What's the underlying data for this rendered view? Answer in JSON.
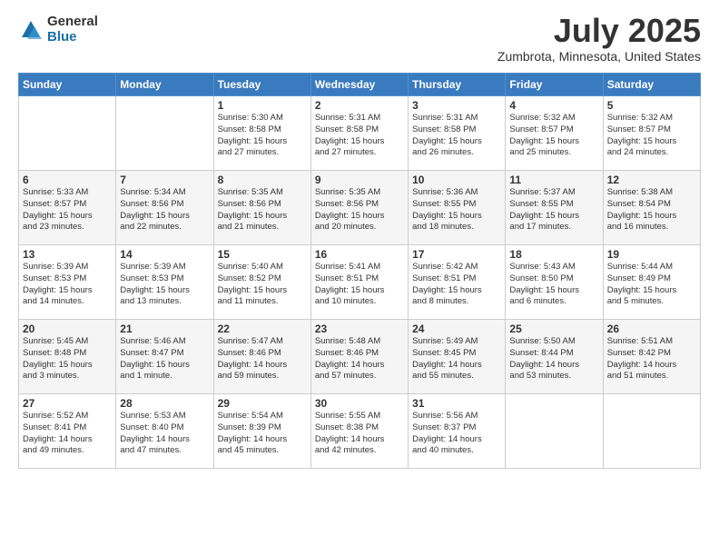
{
  "header": {
    "logo": {
      "general": "General",
      "blue": "Blue"
    },
    "title": "July 2025",
    "location": "Zumbrota, Minnesota, United States"
  },
  "weekdays": [
    "Sunday",
    "Monday",
    "Tuesday",
    "Wednesday",
    "Thursday",
    "Friday",
    "Saturday"
  ],
  "weeks": [
    [
      {
        "day": "",
        "info": ""
      },
      {
        "day": "",
        "info": ""
      },
      {
        "day": "1",
        "info": "Sunrise: 5:30 AM\nSunset: 8:58 PM\nDaylight: 15 hours\nand 27 minutes."
      },
      {
        "day": "2",
        "info": "Sunrise: 5:31 AM\nSunset: 8:58 PM\nDaylight: 15 hours\nand 27 minutes."
      },
      {
        "day": "3",
        "info": "Sunrise: 5:31 AM\nSunset: 8:58 PM\nDaylight: 15 hours\nand 26 minutes."
      },
      {
        "day": "4",
        "info": "Sunrise: 5:32 AM\nSunset: 8:57 PM\nDaylight: 15 hours\nand 25 minutes."
      },
      {
        "day": "5",
        "info": "Sunrise: 5:32 AM\nSunset: 8:57 PM\nDaylight: 15 hours\nand 24 minutes."
      }
    ],
    [
      {
        "day": "6",
        "info": "Sunrise: 5:33 AM\nSunset: 8:57 PM\nDaylight: 15 hours\nand 23 minutes."
      },
      {
        "day": "7",
        "info": "Sunrise: 5:34 AM\nSunset: 8:56 PM\nDaylight: 15 hours\nand 22 minutes."
      },
      {
        "day": "8",
        "info": "Sunrise: 5:35 AM\nSunset: 8:56 PM\nDaylight: 15 hours\nand 21 minutes."
      },
      {
        "day": "9",
        "info": "Sunrise: 5:35 AM\nSunset: 8:56 PM\nDaylight: 15 hours\nand 20 minutes."
      },
      {
        "day": "10",
        "info": "Sunrise: 5:36 AM\nSunset: 8:55 PM\nDaylight: 15 hours\nand 18 minutes."
      },
      {
        "day": "11",
        "info": "Sunrise: 5:37 AM\nSunset: 8:55 PM\nDaylight: 15 hours\nand 17 minutes."
      },
      {
        "day": "12",
        "info": "Sunrise: 5:38 AM\nSunset: 8:54 PM\nDaylight: 15 hours\nand 16 minutes."
      }
    ],
    [
      {
        "day": "13",
        "info": "Sunrise: 5:39 AM\nSunset: 8:53 PM\nDaylight: 15 hours\nand 14 minutes."
      },
      {
        "day": "14",
        "info": "Sunrise: 5:39 AM\nSunset: 8:53 PM\nDaylight: 15 hours\nand 13 minutes."
      },
      {
        "day": "15",
        "info": "Sunrise: 5:40 AM\nSunset: 8:52 PM\nDaylight: 15 hours\nand 11 minutes."
      },
      {
        "day": "16",
        "info": "Sunrise: 5:41 AM\nSunset: 8:51 PM\nDaylight: 15 hours\nand 10 minutes."
      },
      {
        "day": "17",
        "info": "Sunrise: 5:42 AM\nSunset: 8:51 PM\nDaylight: 15 hours\nand 8 minutes."
      },
      {
        "day": "18",
        "info": "Sunrise: 5:43 AM\nSunset: 8:50 PM\nDaylight: 15 hours\nand 6 minutes."
      },
      {
        "day": "19",
        "info": "Sunrise: 5:44 AM\nSunset: 8:49 PM\nDaylight: 15 hours\nand 5 minutes."
      }
    ],
    [
      {
        "day": "20",
        "info": "Sunrise: 5:45 AM\nSunset: 8:48 PM\nDaylight: 15 hours\nand 3 minutes."
      },
      {
        "day": "21",
        "info": "Sunrise: 5:46 AM\nSunset: 8:47 PM\nDaylight: 15 hours\nand 1 minute."
      },
      {
        "day": "22",
        "info": "Sunrise: 5:47 AM\nSunset: 8:46 PM\nDaylight: 14 hours\nand 59 minutes."
      },
      {
        "day": "23",
        "info": "Sunrise: 5:48 AM\nSunset: 8:46 PM\nDaylight: 14 hours\nand 57 minutes."
      },
      {
        "day": "24",
        "info": "Sunrise: 5:49 AM\nSunset: 8:45 PM\nDaylight: 14 hours\nand 55 minutes."
      },
      {
        "day": "25",
        "info": "Sunrise: 5:50 AM\nSunset: 8:44 PM\nDaylight: 14 hours\nand 53 minutes."
      },
      {
        "day": "26",
        "info": "Sunrise: 5:51 AM\nSunset: 8:42 PM\nDaylight: 14 hours\nand 51 minutes."
      }
    ],
    [
      {
        "day": "27",
        "info": "Sunrise: 5:52 AM\nSunset: 8:41 PM\nDaylight: 14 hours\nand 49 minutes."
      },
      {
        "day": "28",
        "info": "Sunrise: 5:53 AM\nSunset: 8:40 PM\nDaylight: 14 hours\nand 47 minutes."
      },
      {
        "day": "29",
        "info": "Sunrise: 5:54 AM\nSunset: 8:39 PM\nDaylight: 14 hours\nand 45 minutes."
      },
      {
        "day": "30",
        "info": "Sunrise: 5:55 AM\nSunset: 8:38 PM\nDaylight: 14 hours\nand 42 minutes."
      },
      {
        "day": "31",
        "info": "Sunrise: 5:56 AM\nSunset: 8:37 PM\nDaylight: 14 hours\nand 40 minutes."
      },
      {
        "day": "",
        "info": ""
      },
      {
        "day": "",
        "info": ""
      }
    ]
  ]
}
